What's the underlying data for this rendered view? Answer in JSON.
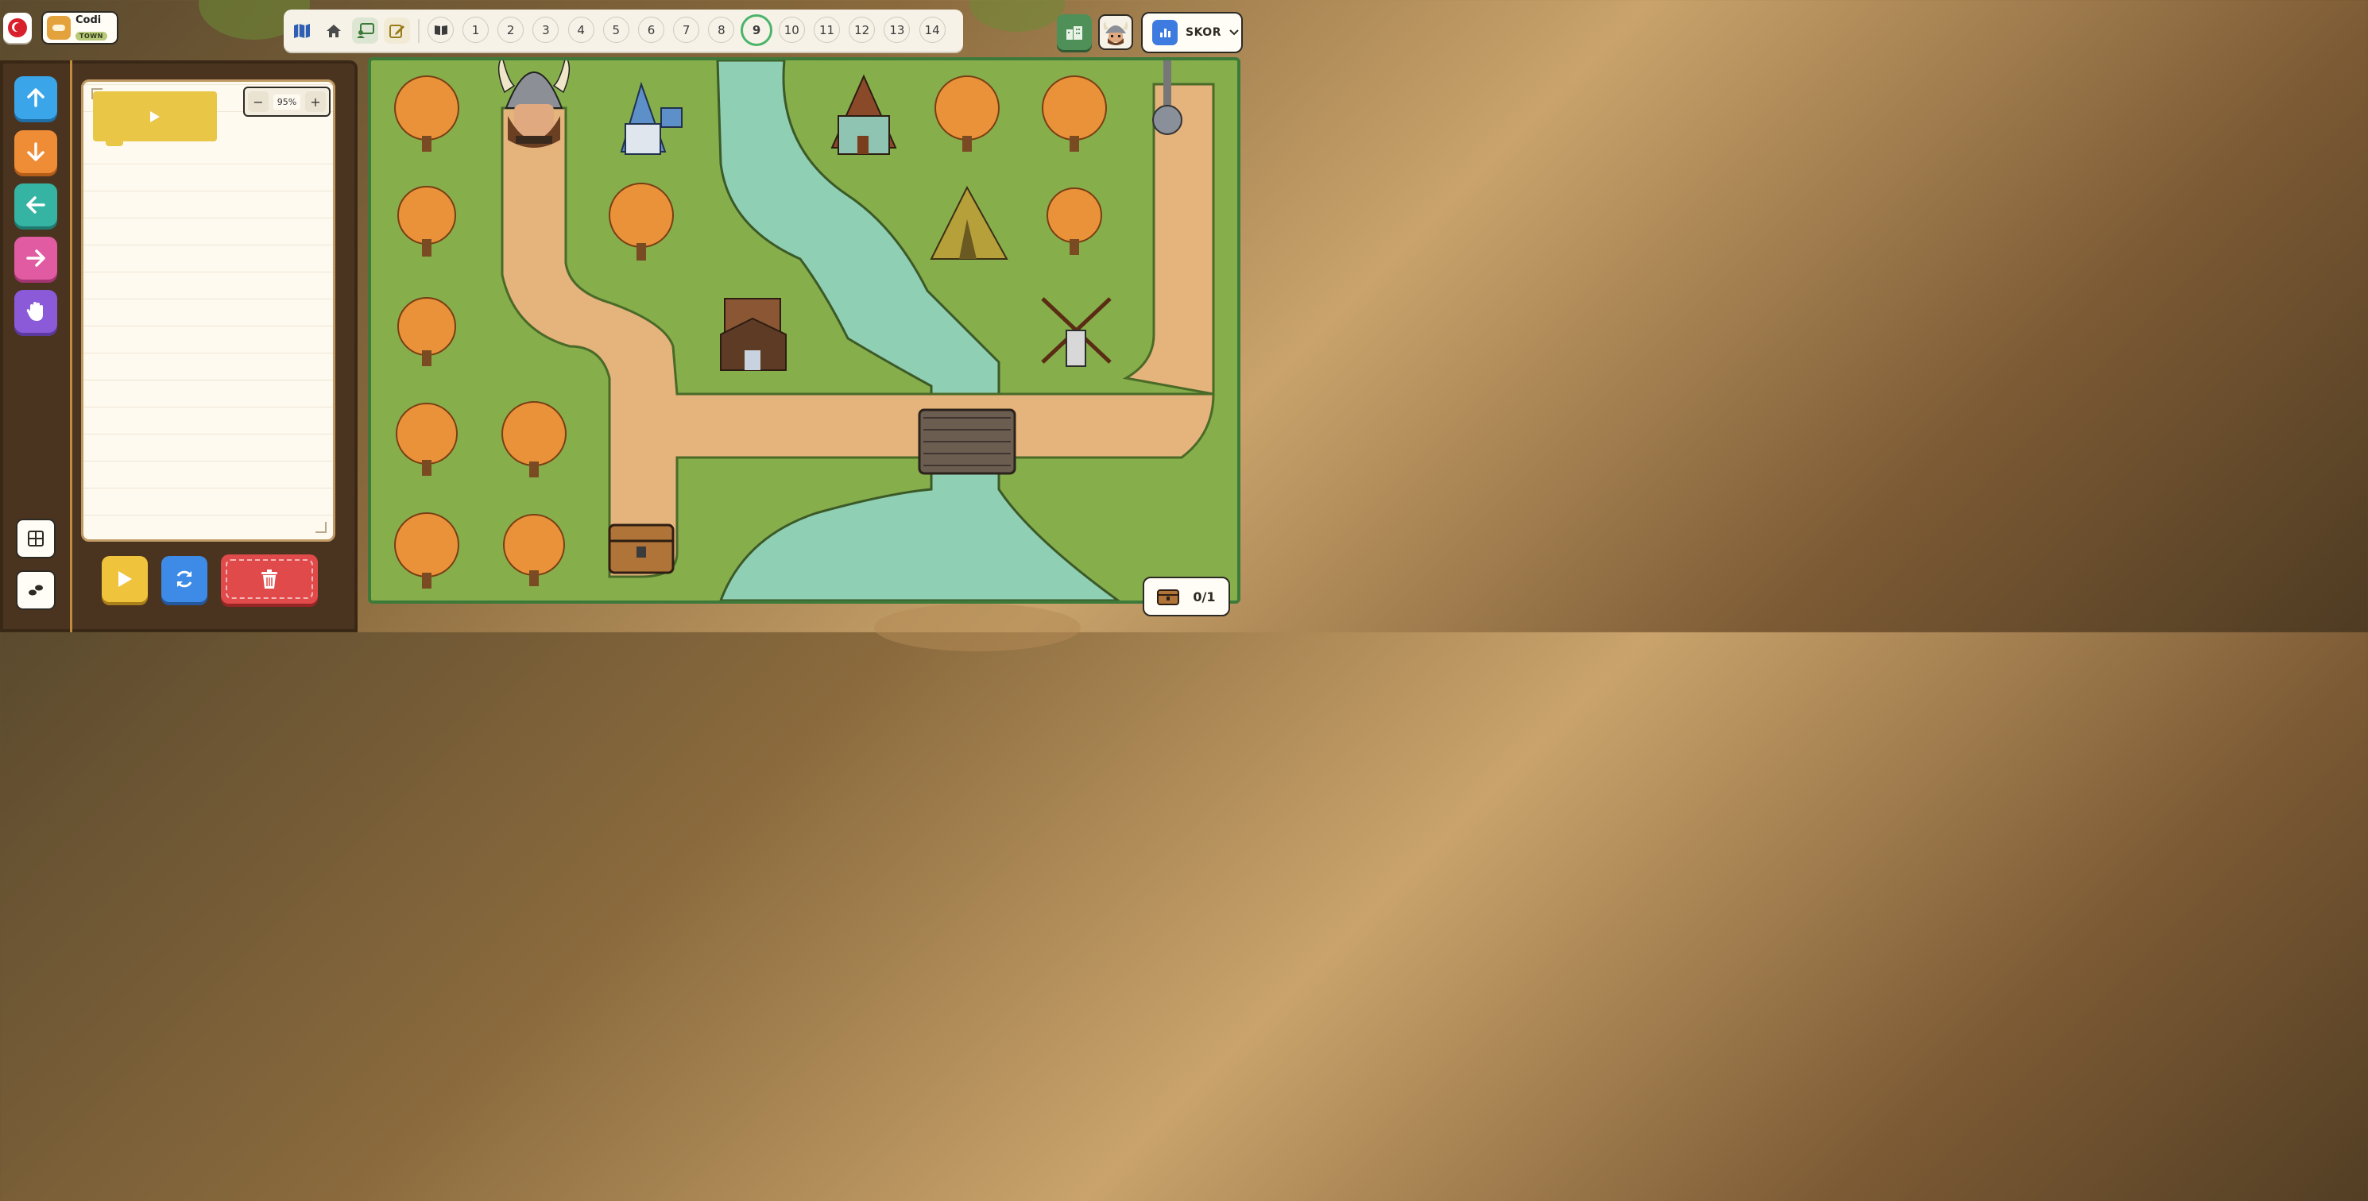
{
  "header": {
    "language_flag": "turkey-flag",
    "app_name": "Codi",
    "app_tag": "TOWN"
  },
  "toolbar": {
    "tools": [
      "map-icon",
      "home-icon",
      "classroom-icon",
      "edit-icon"
    ],
    "book_icon": "book-icon",
    "levels": [
      "1",
      "2",
      "3",
      "4",
      "5",
      "6",
      "7",
      "8",
      "9",
      "10",
      "11",
      "12",
      "13",
      "14"
    ],
    "current_level": "9"
  },
  "top_right": {
    "city_icon": "city-icon",
    "avatar_icon": "viking-avatar-icon",
    "score_label": "SKOR"
  },
  "commands": [
    {
      "name": "move-up-button",
      "icon": "arrow-up-icon",
      "color": "#3aa6e9"
    },
    {
      "name": "move-down-button",
      "icon": "arrow-down-icon",
      "color": "#ef8c36"
    },
    {
      "name": "move-left-button",
      "icon": "arrow-left-icon",
      "color": "#35b3a3"
    },
    {
      "name": "move-right-button",
      "icon": "arrow-right-icon",
      "color": "#e05ba2"
    },
    {
      "name": "stop-button",
      "icon": "hand-icon",
      "color": "#8a5ad8"
    }
  ],
  "workspace": {
    "zoom_level": "95%",
    "zoom_out": "−",
    "zoom_in": "+"
  },
  "controls": {
    "run_icon": "play-icon",
    "reset_icon": "refresh-icon",
    "delete_icon": "trash-icon"
  },
  "map": {
    "character": "viking",
    "goal": "treasure-chest",
    "objects": [
      "trees",
      "blue-house",
      "green-barn",
      "tent",
      "log-cabin",
      "windmill",
      "bridge",
      "river",
      "lamp-post"
    ]
  },
  "chest_counter": "0/1"
}
